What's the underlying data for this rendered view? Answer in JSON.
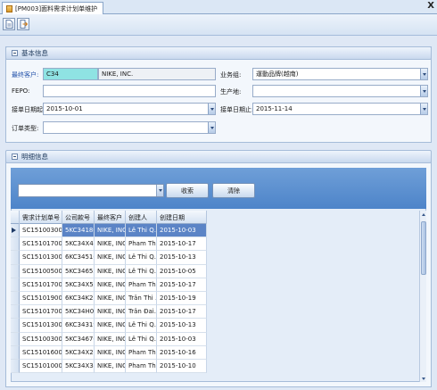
{
  "tab": {
    "title": "[PM003]面料需求计划单维护",
    "close_label": "X"
  },
  "toolbar": {
    "new_icon": "new-doc-icon",
    "export_icon": "export-icon"
  },
  "info_section": {
    "title": "基本信息",
    "customer_label": "最终客户:",
    "customer_code": "C34",
    "customer_name": "NIKE, INC.",
    "business_group_label": "业务组:",
    "business_group_value": "運動品牌(越南)",
    "fepo_label": "FEPO:",
    "fepo_value": "",
    "factory_label": "生产地:",
    "factory_value": "",
    "date_from_label": "接单日期起:",
    "date_from_value": "2015-10-01",
    "date_to_label": "接单日期止:",
    "date_to_value": "2015-11-14",
    "order_type_label": "订单类型:",
    "order_type_value": ""
  },
  "detail_section": {
    "title": "明细信息",
    "search_value": "",
    "search_button": "收索",
    "clear_button": "清除"
  },
  "grid": {
    "columns": [
      "需求计划单号",
      "公司款号",
      "最终客户",
      "创建人",
      "创建日期"
    ],
    "rows": [
      [
        "SC1510030001",
        "5KC34186",
        "NIKE, INC.",
        "Lê Thi Q...",
        "2015-10-03"
      ],
      [
        "SC1510170001",
        "5KC34X40",
        "NIKE, INC.",
        "Pham Th...",
        "2015-10-17"
      ],
      [
        "SC1510130003",
        "6KC34516",
        "NIKE, INC.",
        "Lê Thi Q...",
        "2015-10-13"
      ],
      [
        "SC1510050004",
        "5KC34653",
        "NIKE, INC.",
        "Lê Thi Q...",
        "2015-10-05"
      ],
      [
        "SC1510170026",
        "5KC34X52",
        "NIKE, INC.",
        "Pham Th...",
        "2015-10-17"
      ],
      [
        "SC1510190002",
        "6KC34K21",
        "NIKE, INC.",
        "Trân Thi ...",
        "2015-10-19"
      ],
      [
        "SC1510170022",
        "5KC34H09",
        "NIKE, INC.",
        "Trân Đai...",
        "2015-10-17"
      ],
      [
        "SC1510130002",
        "6KC34319",
        "NIKE, INC.",
        "Lê Thi Q...",
        "2015-10-13"
      ],
      [
        "SC1510030002",
        "5KC34676",
        "NIKE, INC.",
        "Lê Thi Q...",
        "2015-10-03"
      ],
      [
        "SC1510160001",
        "5KC34X24",
        "NIKE, INC.",
        "Pham Th...",
        "2015-10-16"
      ],
      [
        "SC1510100014",
        "5KC34X39",
        "NIKE, INC.",
        "Pham Th...",
        "2015-10-10"
      ]
    ],
    "selected_row": 0
  }
}
